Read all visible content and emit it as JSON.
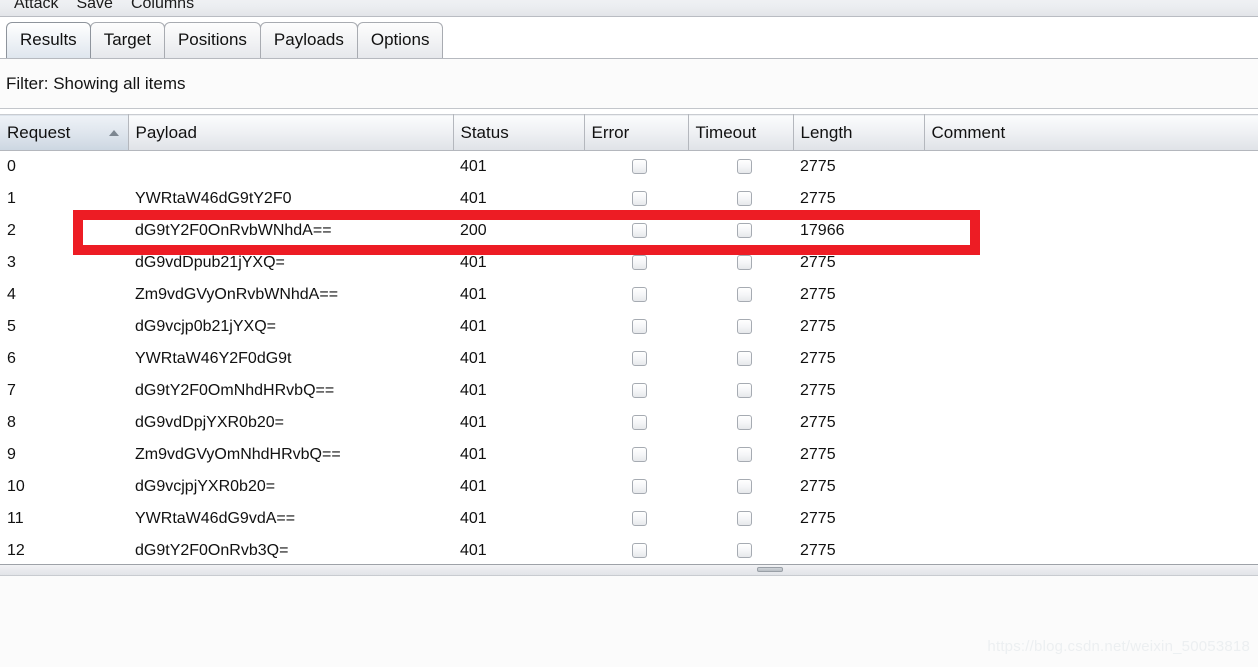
{
  "menubar": {
    "items": [
      "Attack",
      "Save",
      "Columns"
    ]
  },
  "tabs": [
    {
      "label": "Results",
      "selected": true
    },
    {
      "label": "Target",
      "selected": false
    },
    {
      "label": "Positions",
      "selected": false
    },
    {
      "label": "Payloads",
      "selected": false
    },
    {
      "label": "Options",
      "selected": false
    }
  ],
  "filter": {
    "text": "Filter: Showing all items"
  },
  "table": {
    "columns": [
      {
        "label": "Request",
        "key": "request",
        "sorted": true,
        "sort_dir": "asc"
      },
      {
        "label": "Payload",
        "key": "payload",
        "sorted": false
      },
      {
        "label": "Status",
        "key": "status",
        "sorted": false
      },
      {
        "label": "Error",
        "key": "error",
        "sorted": false
      },
      {
        "label": "Timeout",
        "key": "timeout",
        "sorted": false
      },
      {
        "label": "Length",
        "key": "length",
        "sorted": false
      },
      {
        "label": "Comment",
        "key": "comment",
        "sorted": false
      }
    ],
    "rows": [
      {
        "request": "0",
        "payload": "",
        "status": "401",
        "error": false,
        "timeout": false,
        "length": "2775",
        "comment": ""
      },
      {
        "request": "1",
        "payload": "YWRtaW46dG9tY2F0",
        "status": "401",
        "error": false,
        "timeout": false,
        "length": "2775",
        "comment": ""
      },
      {
        "request": "2",
        "payload": "dG9tY2F0OnRvbWNhdA==",
        "status": "200",
        "error": false,
        "timeout": false,
        "length": "17966",
        "comment": ""
      },
      {
        "request": "3",
        "payload": "dG9vdDpub21jYXQ=",
        "status": "401",
        "error": false,
        "timeout": false,
        "length": "2775",
        "comment": ""
      },
      {
        "request": "4",
        "payload": "Zm9vdGVyOnRvbWNhdA==",
        "status": "401",
        "error": false,
        "timeout": false,
        "length": "2775",
        "comment": ""
      },
      {
        "request": "5",
        "payload": "dG9vcjp0b21jYXQ=",
        "status": "401",
        "error": false,
        "timeout": false,
        "length": "2775",
        "comment": ""
      },
      {
        "request": "6",
        "payload": "YWRtaW46Y2F0dG9t",
        "status": "401",
        "error": false,
        "timeout": false,
        "length": "2775",
        "comment": ""
      },
      {
        "request": "7",
        "payload": "dG9tY2F0OmNhdHRvbQ==",
        "status": "401",
        "error": false,
        "timeout": false,
        "length": "2775",
        "comment": ""
      },
      {
        "request": "8",
        "payload": "dG9vdDpjYXR0b20=",
        "status": "401",
        "error": false,
        "timeout": false,
        "length": "2775",
        "comment": ""
      },
      {
        "request": "9",
        "payload": "Zm9vdGVyOmNhdHRvbQ==",
        "status": "401",
        "error": false,
        "timeout": false,
        "length": "2775",
        "comment": ""
      },
      {
        "request": "10",
        "payload": "dG9vcjpjYXR0b20=",
        "status": "401",
        "error": false,
        "timeout": false,
        "length": "2775",
        "comment": ""
      },
      {
        "request": "11",
        "payload": "YWRtaW46dG9vdA==",
        "status": "401",
        "error": false,
        "timeout": false,
        "length": "2775",
        "comment": ""
      },
      {
        "request": "12",
        "payload": "dG9tY2F0OnRvb3Q=",
        "status": "401",
        "error": false,
        "timeout": false,
        "length": "2775",
        "comment": ""
      }
    ]
  },
  "annotation": {
    "color": "#ed1c24",
    "highlighted_request": "2"
  },
  "watermark": {
    "text": "https://blog.csdn.net/weixin_50053818"
  }
}
